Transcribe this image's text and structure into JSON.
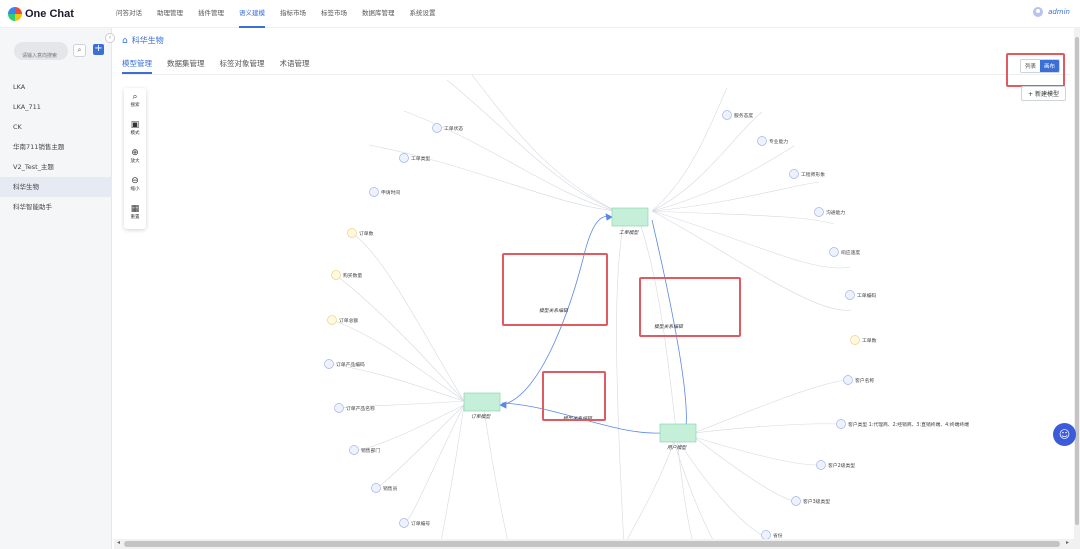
{
  "app": {
    "logo": "One Chat"
  },
  "nav": [
    "问答对话",
    "助理管理",
    "插件管理",
    "语义建模",
    "指标市场",
    "标签市场",
    "数据库管理",
    "系统设置"
  ],
  "nav_active": 3,
  "user": {
    "name": "admin"
  },
  "sidebar": {
    "search_placeholder": "请输入意向搜索",
    "items": [
      "LKA",
      "LKA_711",
      "CK",
      "华南711销售主题",
      "V2_Test_主题",
      "科华生物",
      "科华智能助手"
    ],
    "active": 5
  },
  "breadcrumb": {
    "title": "科华生物"
  },
  "tabs": [
    "模型管理",
    "数据集管理",
    "标签对象管理",
    "术语管理"
  ],
  "tab_active": 0,
  "view_toggle": {
    "list": "列表",
    "canvas": "画布",
    "active": "canvas"
  },
  "new_model_label": "新建模型",
  "toolbar": [
    {
      "icon": "search-icon",
      "label": "搜索"
    },
    {
      "icon": "style-icon",
      "label": "模式"
    },
    {
      "icon": "zoom-in-icon",
      "label": "放大"
    },
    {
      "icon": "zoom-out-icon",
      "label": "缩小"
    },
    {
      "icon": "reset-icon",
      "label": "重置"
    }
  ],
  "models": {
    "work_order": "工单模型",
    "order": "订单模型",
    "customer": "用户模型"
  },
  "relation_label": "模型关系编辑",
  "fields": {
    "work_order_left": [
      "工单状态",
      "工单类型",
      "申请时间"
    ],
    "work_order_right": [
      "服务态度",
      "专业能力",
      "工程师形象",
      "沟通能力",
      "响应速度",
      "工单编码",
      "工单数"
    ],
    "order": [
      "订单数",
      "购买数量",
      "订单总额",
      "订单产品编码",
      "订单产品名称",
      "销售部门",
      "销售员",
      "订单编号",
      "客户类型"
    ],
    "customer": [
      "客户名称",
      "客户类型 1:代理商、2:经销商、3:直销终端、4:终端终端",
      "客户2级类型",
      "客户3级类型",
      "省份",
      "城市"
    ]
  },
  "colors": {
    "accent": "#3b6fd8",
    "model_fill": "#c6efd9",
    "model_stroke": "#7fd1a8",
    "dim_stroke": "#9fb3ee",
    "metric_stroke": "#f2d27a",
    "highlight": "#e05a62"
  }
}
